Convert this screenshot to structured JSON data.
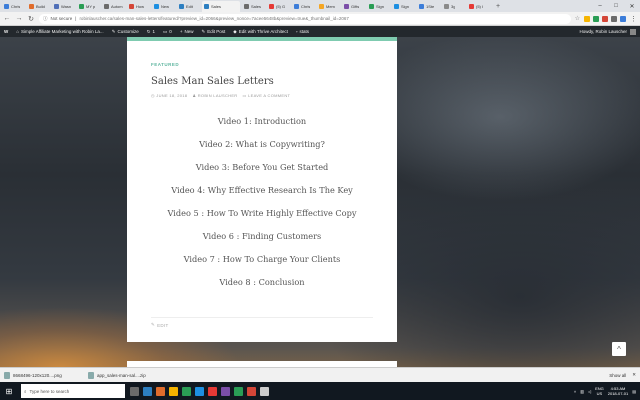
{
  "browser": {
    "tabs": [
      {
        "label": "Chris",
        "color": "#3c7dd9",
        "active": false
      },
      {
        "label": "Build",
        "color": "#e06c2c",
        "active": false
      },
      {
        "label": "Wasn",
        "color": "#4f6fb8",
        "active": false
      },
      {
        "label": "MY p",
        "color": "#2a9d55",
        "active": false
      },
      {
        "label": "Autom",
        "color": "#6b6b6b",
        "active": false
      },
      {
        "label": "How",
        "color": "#d44638",
        "active": false
      },
      {
        "label": "New",
        "color": "#1d8fe1",
        "active": false
      },
      {
        "label": "Edit",
        "color": "#2d7fc1",
        "active": false
      },
      {
        "label": "Sales",
        "color": "#2d7fc1",
        "active": true
      },
      {
        "label": "Sales",
        "color": "#6b6b6b",
        "active": false
      },
      {
        "label": "(5) G",
        "color": "#e53935",
        "active": false
      },
      {
        "label": "Chris",
        "color": "#3c7dd9",
        "active": false
      },
      {
        "label": "Mem",
        "color": "#f5a623",
        "active": false
      },
      {
        "label": "Gifts",
        "color": "#7b4ea8",
        "active": false
      },
      {
        "label": "Sign",
        "color": "#2a9d55",
        "active": false
      },
      {
        "label": "Sign",
        "color": "#1d8fe1",
        "active": false
      },
      {
        "label": "1Ste",
        "color": "#3c7dd9",
        "active": false
      },
      {
        "label": "3g",
        "color": "#8a8a8a",
        "active": false
      },
      {
        "label": "(5) I",
        "color": "#e53935",
        "active": false
      }
    ],
    "newtab_label": "+",
    "window_controls": {
      "minimize": "–",
      "maximize": "□",
      "close": "✕"
    },
    "nav": {
      "back": "←",
      "forward": "→",
      "reload": "↻"
    },
    "security": "Not secure",
    "url": "robinlauscher.ca/sales-man-sales-letters/featured/?preview_id=2066&preview_nonce=7acee5648b&preview=true&_thumbnail_id=2067",
    "extension_colors": [
      "#f5b400",
      "#2a9d55",
      "#d44638",
      "#6b6b6b",
      "#3c7dd9"
    ]
  },
  "wp_admin_bar": {
    "wp_icon": "W",
    "site_name": "Simple Affiliate Marketing with Robin La...",
    "customize": "Customize",
    "comments_count": "0",
    "updates_count": "1",
    "new": "New",
    "edit_post": "Edit Post",
    "thrive": "Edit with Thrive Architect",
    "image_alt": "stats",
    "howdy": "Howdy, Robin Lauscher"
  },
  "post": {
    "category": "FEATURED",
    "title": "Sales Man Sales Letters",
    "date": "JUNE 18, 2018",
    "author": "ROBIN LAUSCHER",
    "comment": "LEAVE A COMMENT",
    "videos": [
      "Video 1: Introduction",
      "Video 2: What is Copywriting?",
      "Video 3: Before You Get Started",
      "Video 4: Why Effective Research Is The Key",
      "Video 5 : How To Write Highly Effective Copy",
      "Video 6 : Finding Customers",
      "Video 7 : How To Charge Your Clients",
      "Video 8 : Conclusion"
    ],
    "edit": "EDIT"
  },
  "scroll_top": "^",
  "downloads": {
    "items": [
      {
        "name": "8668496-120x120....png"
      },
      {
        "name": "app_sales-man-sal....zip"
      }
    ],
    "show_all": "Show all",
    "close": "✕"
  },
  "taskbar": {
    "search_placeholder": "Type here to search",
    "app_colors": [
      "#6b6b6b",
      "#2d7fc1",
      "#e06c2c",
      "#f5b400",
      "#2a9d55",
      "#1d8fe1",
      "#e53935",
      "#7b4ea8",
      "#2a9d55",
      "#d44638",
      "#cccccc"
    ],
    "lang": "ENG",
    "region": "US",
    "time": "4:53 AM",
    "date": "2018-07-01"
  }
}
